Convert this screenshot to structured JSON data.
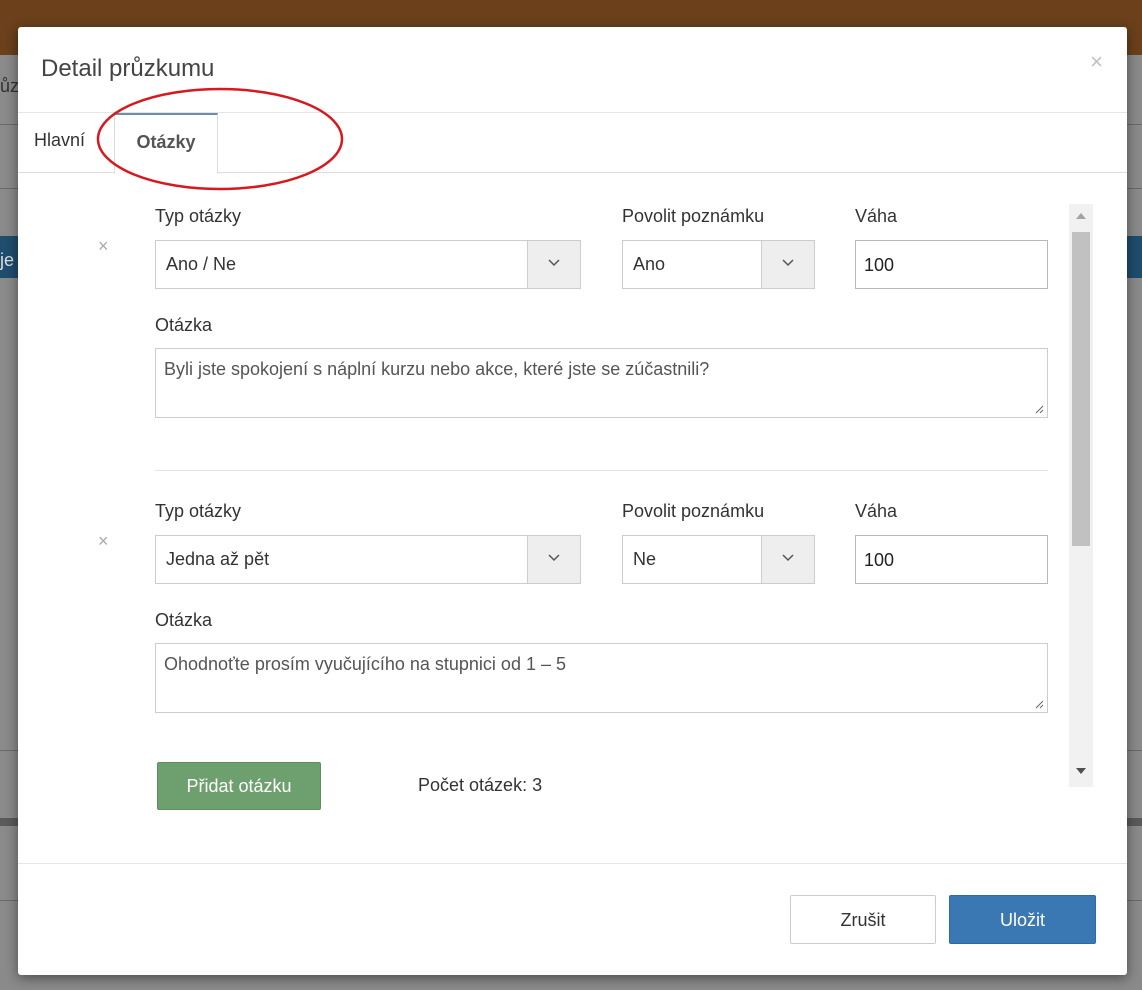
{
  "background": {
    "fragment_top": "ůz",
    "fragment_blue": "je"
  },
  "modal": {
    "title": "Detail průzkumu",
    "close_symbol": "×",
    "tabs": [
      {
        "label": "Hlavní",
        "active": false
      },
      {
        "label": "Otázky",
        "active": true
      }
    ],
    "annotation": "red-ellipse-around-active-tab",
    "questions": [
      {
        "remove_symbol": "×",
        "type_label": "Typ otázky",
        "type_value": "Ano / Ne",
        "note_label": "Povolit poznámku",
        "note_value": "Ano",
        "weight_label": "Váha",
        "weight_value": "100",
        "question_label": "Otázka",
        "question_text": "Byli jste spokojení s náplní kurzu nebo akce, které jste se zúčastnili?"
      },
      {
        "remove_symbol": "×",
        "type_label": "Typ otázky",
        "type_value": "Jedna až pět",
        "note_label": "Povolit poznámku",
        "note_value": "Ne",
        "weight_label": "Váha",
        "weight_value": "100",
        "question_label": "Otázka",
        "question_text": "Ohodnoťte prosím vyučujícího na stupnici od 1 – 5"
      }
    ],
    "add_button": "Přidat otázku",
    "count_text": "Počet otázek: 3",
    "cancel_button": "Zrušit",
    "save_button": "Uložit",
    "colors": {
      "add_button": "#6e9f6e",
      "save_button": "#3a78b4",
      "annotation": "#d6191f"
    }
  }
}
